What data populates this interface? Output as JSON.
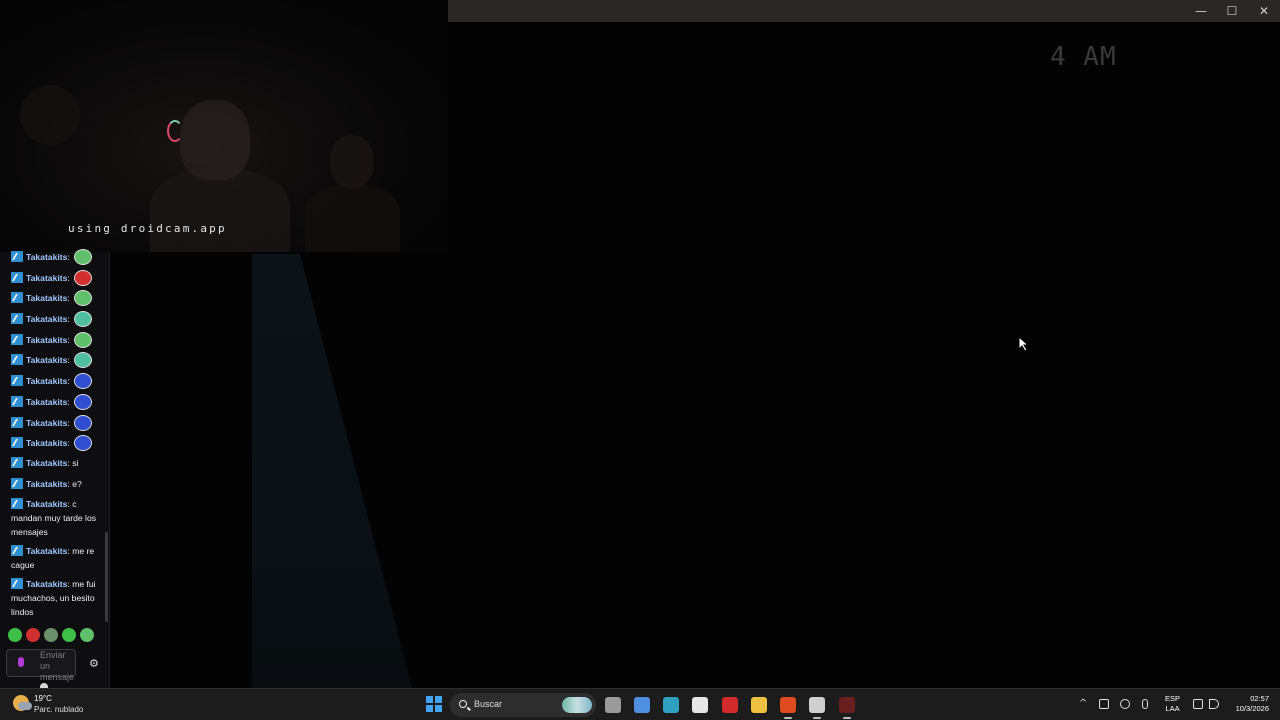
{
  "webcam": {
    "watermark": "using droidcam.app"
  },
  "game": {
    "clock": "4 AM"
  },
  "window_controls": {
    "minimize": "—",
    "maximize": "☐",
    "close": "✕"
  },
  "chat": {
    "messages": [
      {
        "user": "Takatakits",
        "text": "",
        "emote_color": "#5fbf6a"
      },
      {
        "user": "Takatakits",
        "text": "",
        "emote_color": "#d23030"
      },
      {
        "user": "Takatakits",
        "text": "",
        "emote_color": "#5fbf6a"
      },
      {
        "user": "Takatakits",
        "text": "",
        "emote_color": "#4fbfa0"
      },
      {
        "user": "Takatakits",
        "text": "",
        "emote_color": "#5fbf6a"
      },
      {
        "user": "Takatakits",
        "text": "",
        "emote_color": "#4fbfa0"
      },
      {
        "user": "Takatakits",
        "text": "",
        "emote_color": "#2f4fd0"
      },
      {
        "user": "Takatakits",
        "text": "",
        "emote_color": "#2f4fd0"
      },
      {
        "user": "Takatakits",
        "text": "",
        "emote_color": "#2f4fd0"
      },
      {
        "user": "Takatakits",
        "text": "",
        "emote_color": "#2f4fd0"
      },
      {
        "user": "Takatakits",
        "text": "si"
      },
      {
        "user": "Takatakits",
        "text": "e?"
      },
      {
        "user": "Takatakits",
        "text": "c mandan muy tarde los mensajes"
      },
      {
        "user": "Takatakits",
        "text": "me re cague"
      },
      {
        "user": "Takatakits",
        "text": "me fui muchachos, un besito lindos"
      }
    ],
    "emote_bar": [
      "#3fbf4a",
      "#d03030",
      "#6a8f6a",
      "#3fbf4a",
      "#5fbf6a"
    ],
    "input_placeholder": "Enviar un mensaje",
    "settings_icon": "⚙"
  },
  "taskbar": {
    "weather_temp": "19°C",
    "weather_desc": "Parc. nublado",
    "search_label": "Buscar",
    "apps": [
      {
        "name": "task-view",
        "color": "#9a9a9a"
      },
      {
        "name": "copilot",
        "color": "#4f8fe0"
      },
      {
        "name": "edge",
        "color": "#2fa0c0"
      },
      {
        "name": "store",
        "color": "#e6e6e6"
      },
      {
        "name": "wps",
        "color": "#d02a2a"
      },
      {
        "name": "file-explorer",
        "color": "#f0c040"
      },
      {
        "name": "brave",
        "color": "#e04a20"
      },
      {
        "name": "obs",
        "color": "#cfcfcf"
      },
      {
        "name": "game",
        "color": "#6a1f1f"
      }
    ],
    "language_line1": "ESP",
    "language_line2": "LAA",
    "time": "02:57",
    "date": "10/3/2026"
  }
}
